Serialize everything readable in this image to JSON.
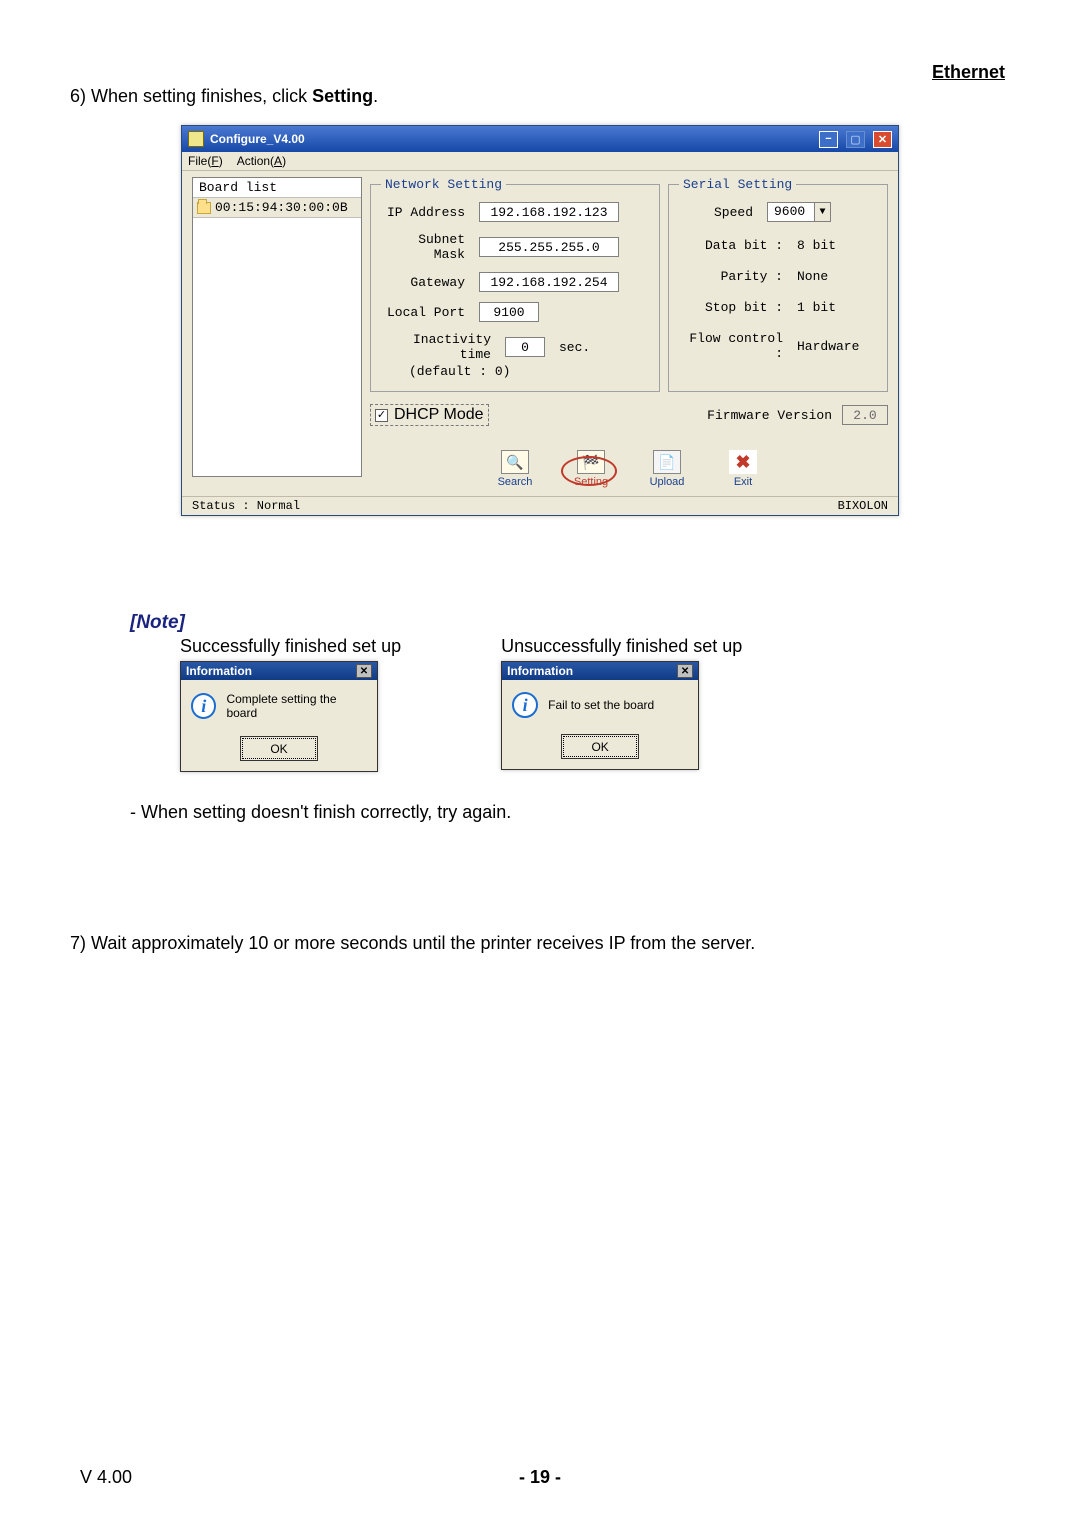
{
  "header_right": "Ethernet",
  "step6_prefix": "6) When setting finishes, click ",
  "step6_bold": "Setting",
  "step6_suffix": ".",
  "window": {
    "title": "Configure_V4.00",
    "menu_file": "File(F)",
    "menu_action": "Action(A)",
    "board_list": {
      "header": "Board list",
      "mac": "00:15:94:30:00:0B"
    },
    "network": {
      "legend": "Network Setting",
      "ip_label": "IP Address",
      "ip_value": "192.168.192.123",
      "subnet_label": "Subnet Mask",
      "subnet_value": "255.255.255.0",
      "gateway_label": "Gateway",
      "gateway_value": "192.168.192.254",
      "localport_label": "Local Port",
      "localport_value": "9100",
      "inact_label": "Inactivity time",
      "inact_value": "0",
      "inact_sec": "sec.",
      "inact_default": "(default : 0)"
    },
    "serial": {
      "legend": "Serial Setting",
      "speed_label": "Speed",
      "speed_value": "9600",
      "data_label": "Data bit :",
      "data_value": "8 bit",
      "parity_label": "Parity :",
      "parity_value": "None",
      "stop_label": "Stop bit :",
      "stop_value": "1 bit",
      "flow_label": "Flow control :",
      "flow_value": "Hardware"
    },
    "dhcp_label": "DHCP Mode",
    "fw_label": "Firmware Version",
    "fw_value": "2.0",
    "buttons": {
      "search": "Search",
      "setting": "Setting",
      "upload": "Upload",
      "exit": "Exit"
    },
    "status_left": "Status : Normal",
    "status_right": "BIXOLON"
  },
  "note": {
    "title": "[Note]",
    "success_label": "Successfully finished set up",
    "fail_label": "Unsuccessfully finished set up",
    "info_title": "Information",
    "success_msg": "Complete setting the board",
    "fail_msg": "Fail to set the board",
    "ok": "OK"
  },
  "after_note": "- When setting doesn't finish correctly, try again.",
  "step7": "7) Wait approximately 10 or more seconds until the printer receives IP from the server.",
  "footer_left": "V 4.00",
  "footer_center": "- 19 -"
}
